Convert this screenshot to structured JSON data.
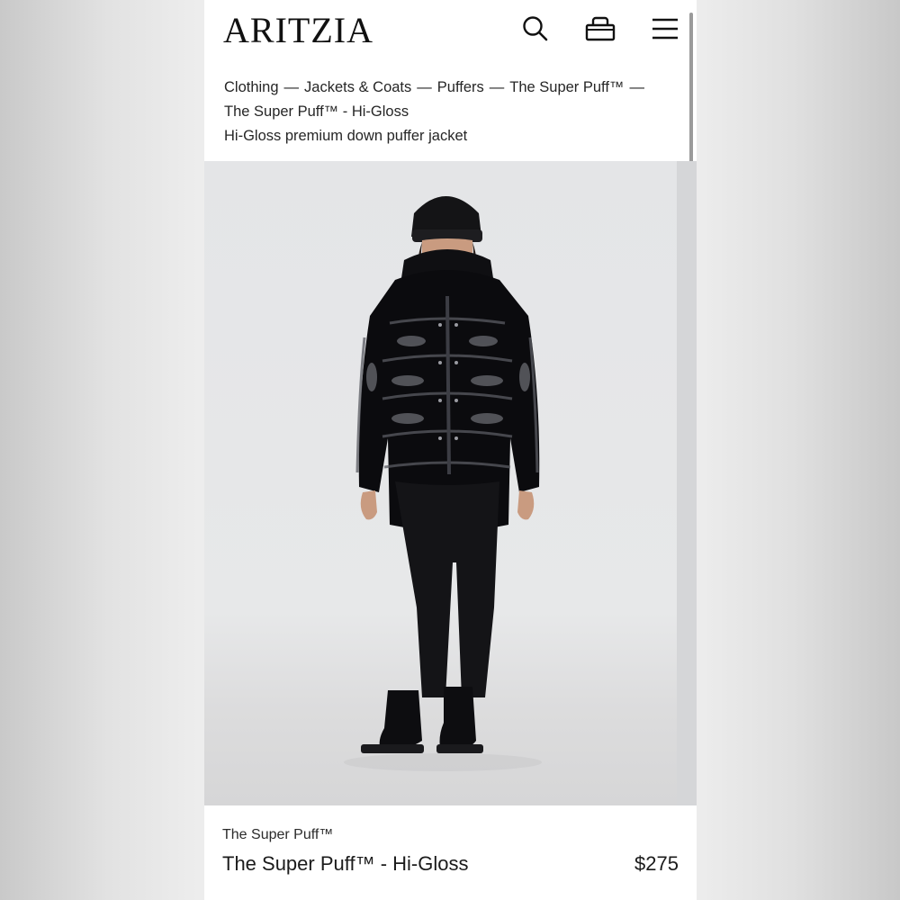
{
  "header": {
    "logo": "ARITZIA",
    "icons": [
      "search-icon",
      "shopping-bag-icon",
      "menu-icon"
    ]
  },
  "breadcrumb": {
    "items": [
      "Clothing",
      "Jackets & Coats",
      "Puffers",
      "The Super Puff™",
      "The Super Puff™ - Hi-Gloss"
    ],
    "separator": "—"
  },
  "page": {
    "subtitle": "Hi-Gloss premium down puffer jacket"
  },
  "product": {
    "brand": "The Super Puff™",
    "name": "The Super Puff™ - Hi-Gloss",
    "price": "$275",
    "image_alt": "Model wearing black hi-gloss puffer jacket"
  },
  "colors": {
    "background": "#ececec",
    "text": "#1b1b1b",
    "hero_bg": "#e5e6e8"
  }
}
